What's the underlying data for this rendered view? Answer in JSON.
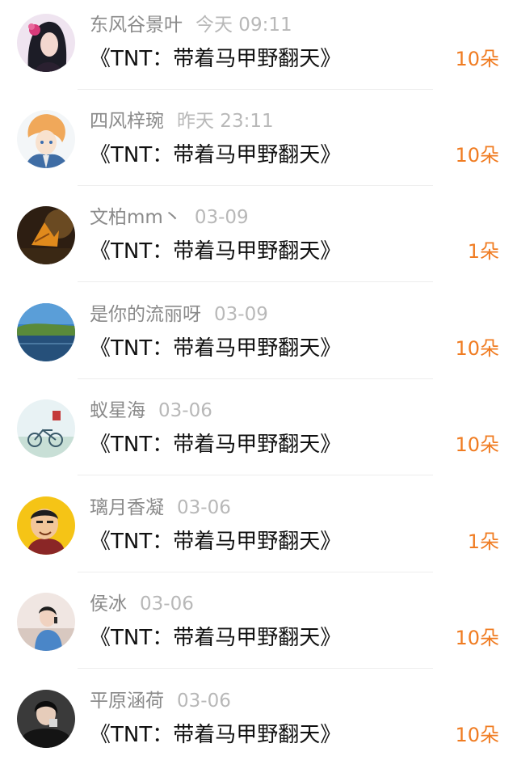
{
  "accent_color": "#f07c22",
  "entries": [
    {
      "name": "东风谷景叶",
      "time": "今天 09:11",
      "title": "《TNT：带着马甲野翻天》",
      "amount": "10朵",
      "avatar_icon": "girl-with-flower-avatar"
    },
    {
      "name": "四风梓琬",
      "time": "昨天 23:11",
      "title": "《TNT：带着马甲野翻天》",
      "amount": "10朵",
      "avatar_icon": "anime-boy-avatar"
    },
    {
      "name": "文柏mm丶",
      "time": "03-09",
      "title": "《TNT：带着马甲野翻天》",
      "amount": "1朵",
      "avatar_icon": "autumn-leaf-avatar"
    },
    {
      "name": "是你的流丽呀",
      "time": "03-09",
      "title": "《TNT：带着马甲野翻天》",
      "amount": "10朵",
      "avatar_icon": "lake-landscape-avatar"
    },
    {
      "name": "蚁星海",
      "time": "03-06",
      "title": "《TNT：带着马甲野翻天》",
      "amount": "10朵",
      "avatar_icon": "bicycle-avatar"
    },
    {
      "name": "璃月香凝",
      "time": "03-06",
      "title": "《TNT：带着马甲野翻天》",
      "amount": "1朵",
      "avatar_icon": "cartoon-man-avatar"
    },
    {
      "name": "侯冰",
      "time": "03-06",
      "title": "《TNT：带着马甲野翻天》",
      "amount": "10朵",
      "avatar_icon": "person-on-phone-avatar"
    },
    {
      "name": "平原涵荷",
      "time": "03-06",
      "title": "《TNT：带着马甲野翻天》",
      "amount": "10朵",
      "avatar_icon": "dark-hair-person-avatar"
    }
  ]
}
